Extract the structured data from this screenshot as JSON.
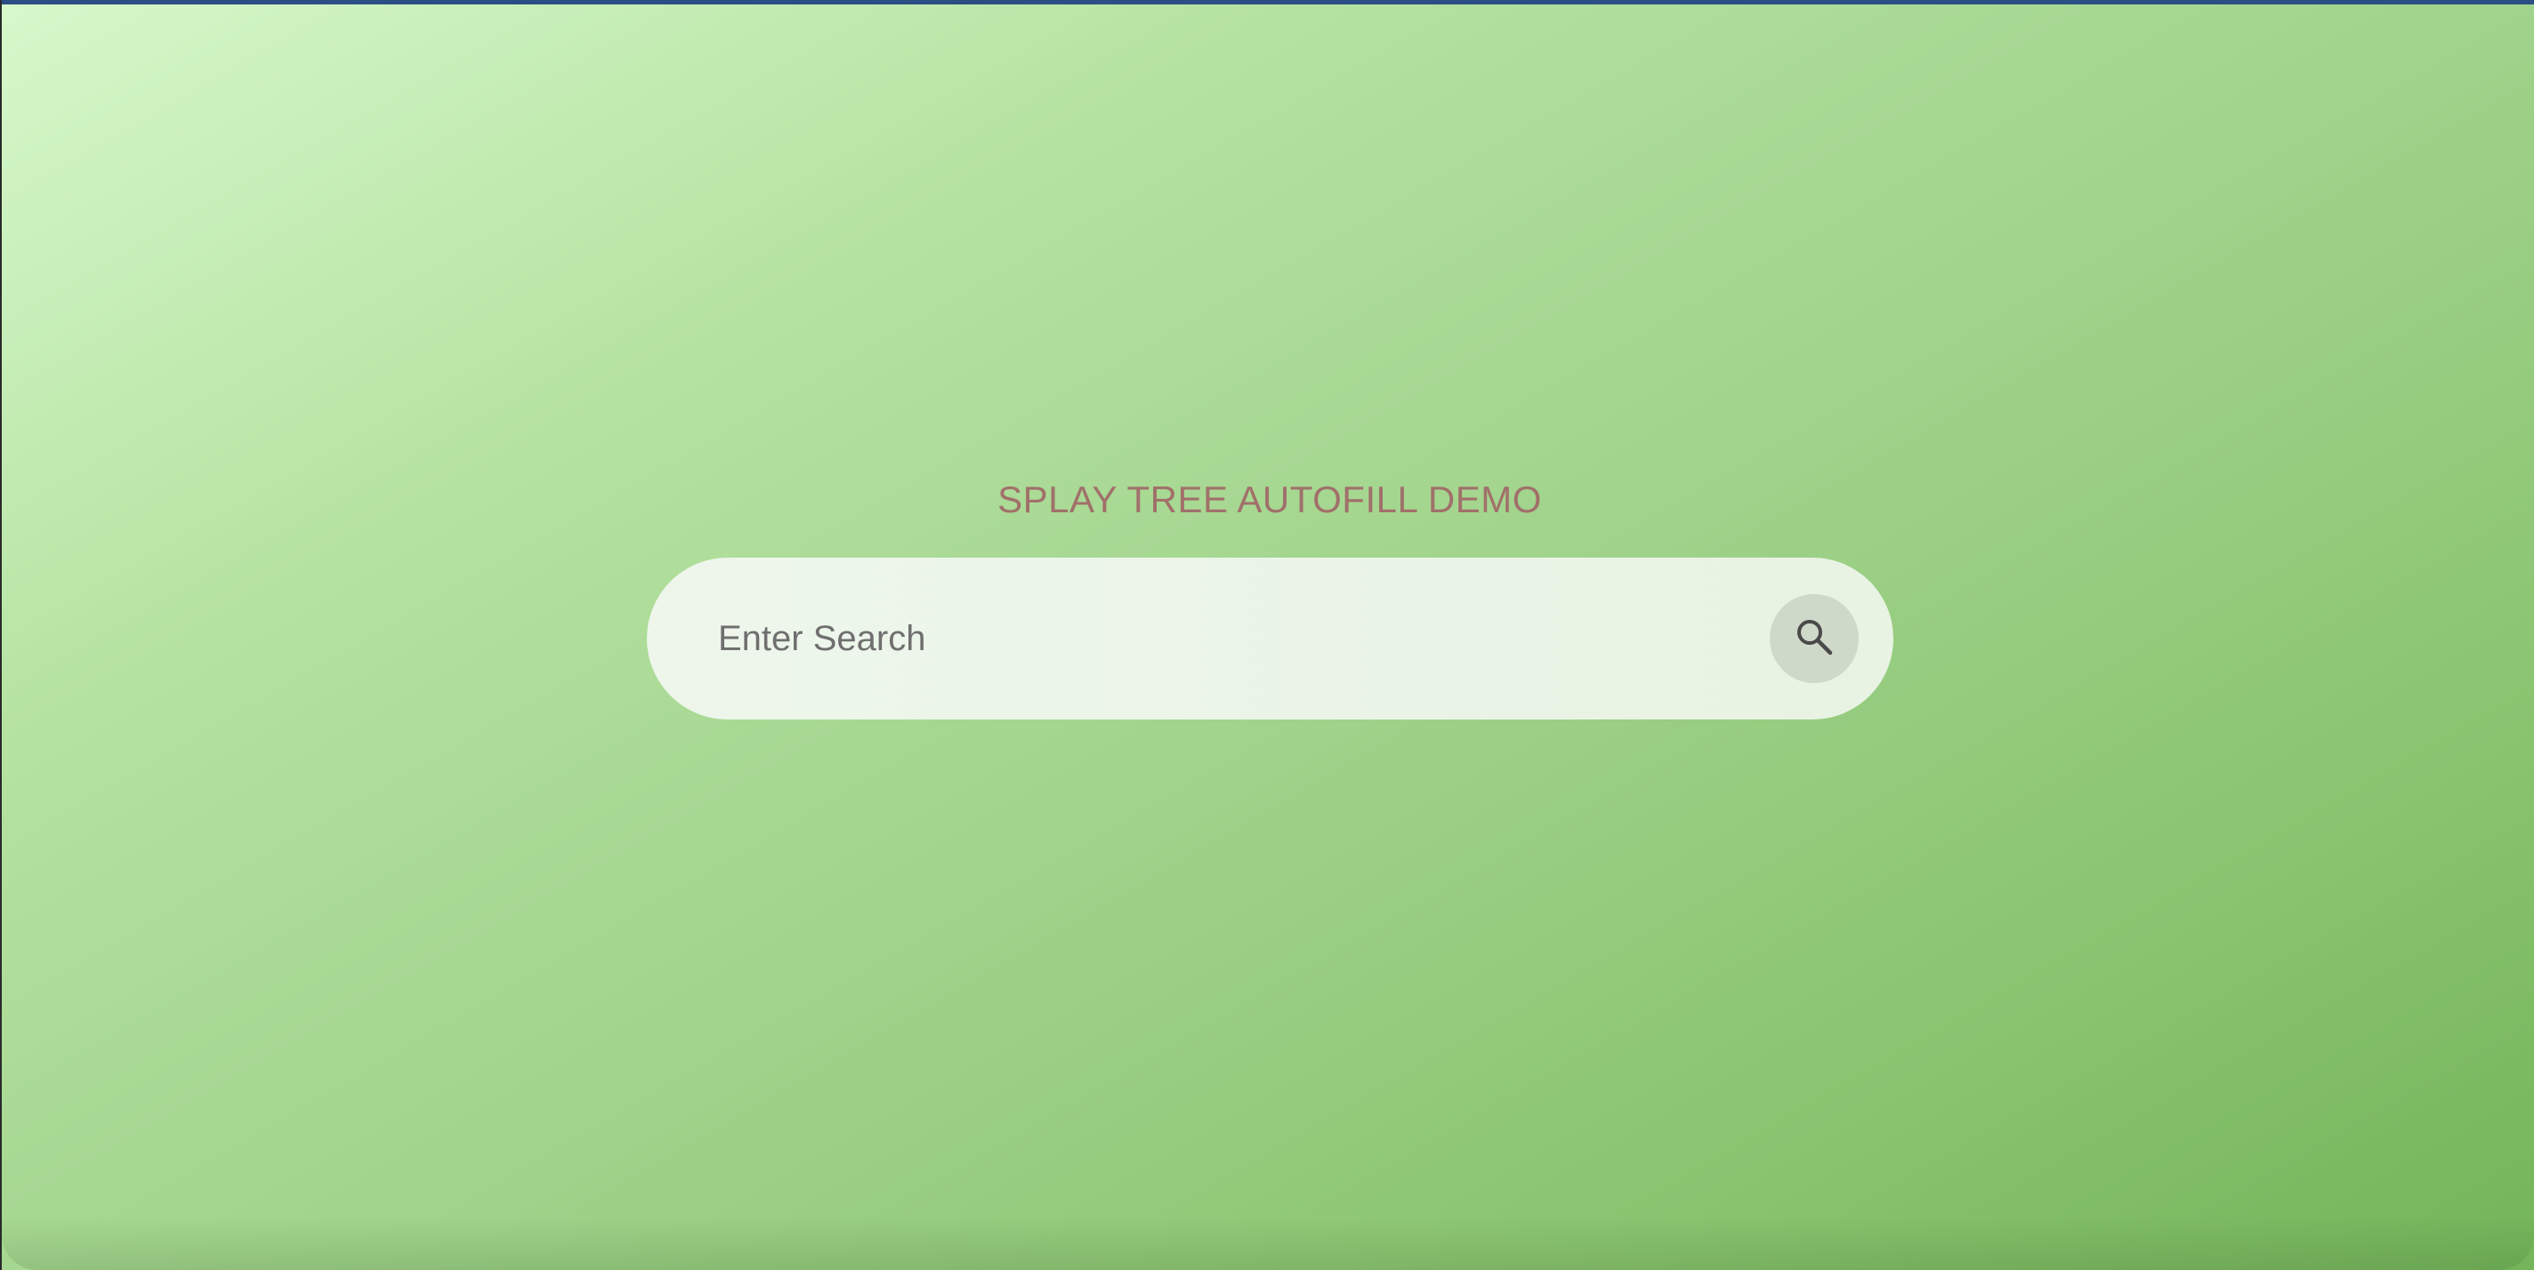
{
  "page": {
    "title": "SPLAY TREE AUTOFILL DEMO"
  },
  "search": {
    "placeholder": "Enter Search",
    "value": "",
    "button_icon": "search-icon"
  },
  "colors": {
    "title": "#a1706a",
    "background_start": "#d6f8cb",
    "background_end": "#74b45a",
    "search_bar": "#eef6ec",
    "search_button": "#cfd9ca",
    "top_bar": "#2b4f85"
  }
}
